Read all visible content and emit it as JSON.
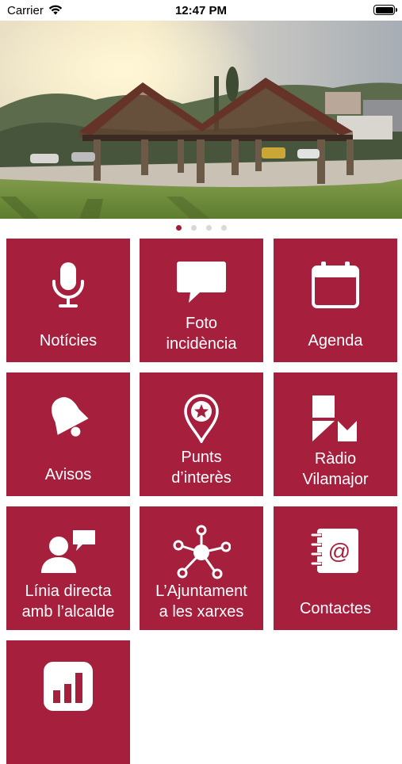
{
  "status": {
    "carrier": "Carrier",
    "time": "12:47 PM"
  },
  "carousel": {
    "pages": 4,
    "active": 0
  },
  "tiles": [
    {
      "id": "noticies",
      "label": "Notícies",
      "icon": "microphone-icon"
    },
    {
      "id": "foto",
      "label": "Foto\nincidència",
      "icon": "speech-bubble-icon"
    },
    {
      "id": "agenda",
      "label": "Agenda",
      "icon": "calendar-icon"
    },
    {
      "id": "avisos",
      "label": "Avisos",
      "icon": "bell-icon"
    },
    {
      "id": "punts",
      "label": "Punts\nd’interès",
      "icon": "map-pin-star-icon"
    },
    {
      "id": "radio",
      "label": "Ràdio\nVilamajor",
      "icon": "radio-logo-icon"
    },
    {
      "id": "linia",
      "label": "Línia directa\namb l’alcalde",
      "icon": "user-chat-icon"
    },
    {
      "id": "xarxes",
      "label": "L’Ajuntament\na les xarxes",
      "icon": "network-icon"
    },
    {
      "id": "contactes",
      "label": "Contactes",
      "icon": "address-book-icon"
    },
    {
      "id": "stats",
      "label": "",
      "icon": "bar-chart-icon"
    }
  ],
  "colors": {
    "tile": "#a6203d",
    "accent": "#a11c39"
  }
}
